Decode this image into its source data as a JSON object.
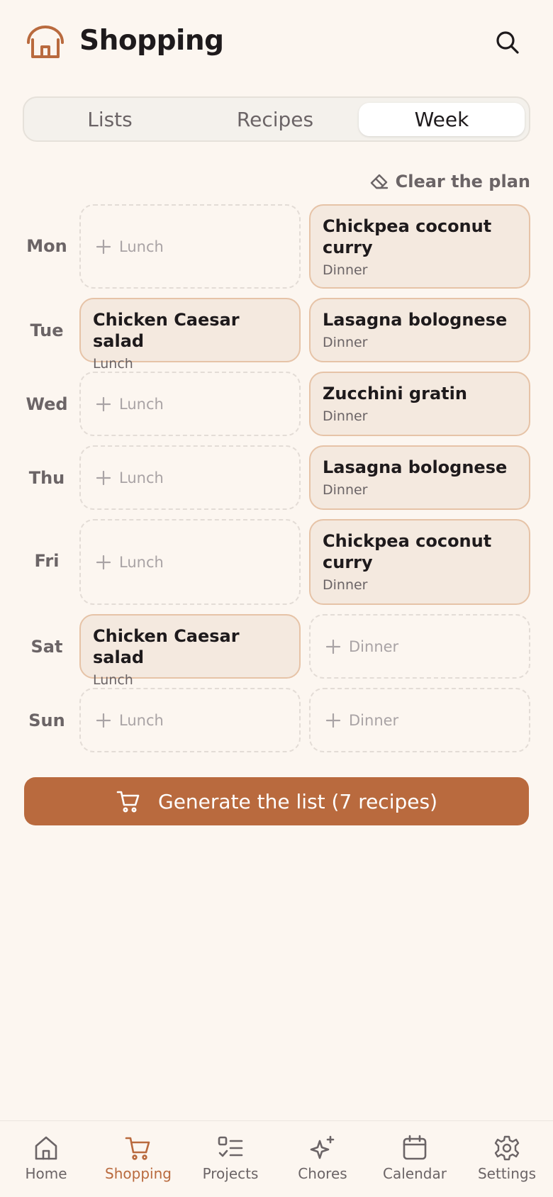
{
  "header": {
    "title": "Shopping"
  },
  "tabs": [
    {
      "label": "Lists"
    },
    {
      "label": "Recipes"
    },
    {
      "label": "Week",
      "selected": true
    }
  ],
  "clear_label": "Clear the plan",
  "week": [
    {
      "day": "Mon",
      "lunch": {
        "empty": true,
        "label": "Lunch"
      },
      "dinner": {
        "name": "Chickpea coconut curry",
        "type": "Dinner"
      }
    },
    {
      "day": "Tue",
      "lunch": {
        "name": "Chicken Caesar salad",
        "type": "Lunch"
      },
      "dinner": {
        "name": "Lasagna bolognese",
        "type": "Dinner"
      }
    },
    {
      "day": "Wed",
      "lunch": {
        "empty": true,
        "label": "Lunch"
      },
      "dinner": {
        "name": "Zucchini gratin",
        "type": "Dinner"
      }
    },
    {
      "day": "Thu",
      "lunch": {
        "empty": true,
        "label": "Lunch"
      },
      "dinner": {
        "name": "Lasagna bolognese",
        "type": "Dinner"
      }
    },
    {
      "day": "Fri",
      "lunch": {
        "empty": true,
        "label": "Lunch"
      },
      "dinner": {
        "name": "Chickpea coconut curry",
        "type": "Dinner"
      }
    },
    {
      "day": "Sat",
      "lunch": {
        "name": "Chicken Caesar salad",
        "type": "Lunch"
      },
      "dinner": {
        "empty": true,
        "label": "Dinner"
      }
    },
    {
      "day": "Sun",
      "lunch": {
        "empty": true,
        "label": "Lunch"
      },
      "dinner": {
        "empty": true,
        "label": "Dinner"
      }
    }
  ],
  "generate_label": "Generate the list (7 recipes)",
  "nav": [
    {
      "label": "Home",
      "icon": "home-icon"
    },
    {
      "label": "Shopping",
      "icon": "cart-icon",
      "active": true
    },
    {
      "label": "Projects",
      "icon": "checklist-icon"
    },
    {
      "label": "Chores",
      "icon": "sparkle-icon"
    },
    {
      "label": "Calendar",
      "icon": "calendar-icon"
    },
    {
      "label": "Settings",
      "icon": "gear-icon"
    }
  ],
  "colors": {
    "accent": "#b96a3e",
    "background": "#fcf6f0",
    "card": "#f4e9df",
    "card_border": "#e6c3a7",
    "muted_text": "#6b6466"
  }
}
